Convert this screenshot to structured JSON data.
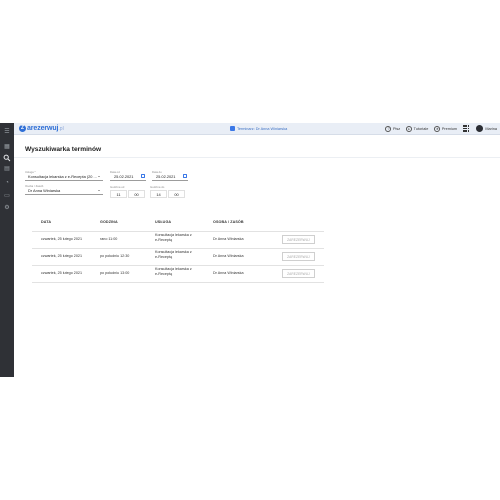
{
  "brand": {
    "logo_mark": "Z",
    "name": "arezerwuj",
    "suffix": ".pl"
  },
  "topbar": {
    "notice": "Terminarz: Dr Anna Winiarska",
    "actions": [
      {
        "name": "help",
        "icon": "help-circle-icon",
        "label": "Pisz"
      },
      {
        "name": "tutorials",
        "icon": "play-circle-icon",
        "label": "Tutoriale"
      },
      {
        "name": "premium",
        "icon": "star-circle-icon",
        "label": "Premium"
      }
    ],
    "user": "Marina"
  },
  "sidebar": {
    "icons": [
      "menu-icon",
      "calendar-icon",
      "search-icon",
      "clipboard-icon",
      "clock-icon",
      "folder-icon",
      "gear-icon"
    ],
    "active": "search-icon"
  },
  "page": {
    "title": "Wyszukiwarka terminów"
  },
  "form": {
    "service": {
      "label": "Usługa *",
      "value": "Konsultacja lekarska z e-Recepta (20 ..."
    },
    "date_from": {
      "label": "Data od",
      "value": "25.02.2021"
    },
    "date_to": {
      "label": "Data do",
      "value": "25.02.2021"
    },
    "person": {
      "label": "Osoba / Zasób",
      "value": "Dr Anna Winiarska"
    },
    "hour_from": {
      "label": "Godzina od",
      "hour": "11",
      "minute": "00"
    },
    "hour_to": {
      "label": "Godzina do",
      "hour": "14",
      "minute": "00"
    }
  },
  "table": {
    "headers": [
      "DATA",
      "GODZINA",
      "USŁUGA",
      "OSOBA / ZASÓB"
    ],
    "rows": [
      {
        "date": "czwartek, 25 lutego 2021",
        "time": "rano 11:00",
        "service_1": "Konsultacja lekarska z",
        "service_2": "e-Receptą",
        "person": "Dr Anna Winiarska",
        "action": "ZAREZERWUJ"
      },
      {
        "date": "czwartek, 25 lutego 2021",
        "time": "po południu 12:30",
        "service_1": "Konsultacja lekarska z",
        "service_2": "e-Receptą",
        "person": "Dr Anna Winiarska",
        "action": "ZAREZERWUJ"
      },
      {
        "date": "czwartek, 25 lutego 2021",
        "time": "po południu 13:00",
        "service_1": "Konsultacja lekarska z",
        "service_2": "e-Receptą",
        "person": "Dr Anna Winiarska",
        "action": "ZAREZERWUJ"
      }
    ]
  },
  "colors": {
    "accent": "#3b78e7",
    "sidebar": "#2f3136",
    "topbar": "#e9eef6"
  }
}
